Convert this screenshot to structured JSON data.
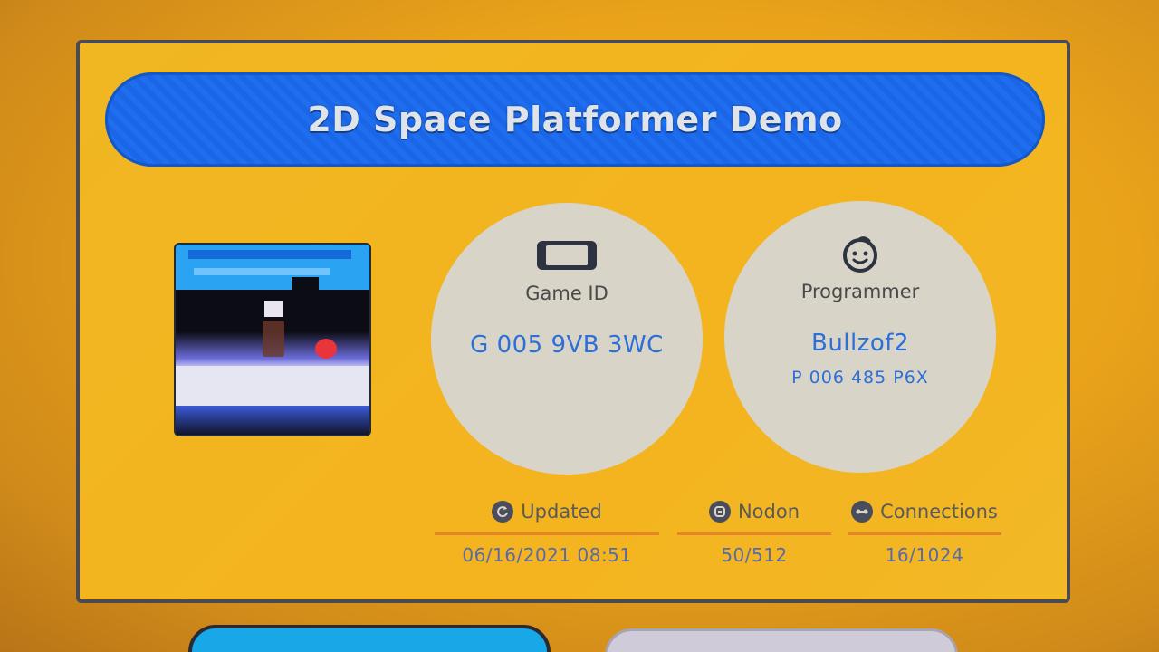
{
  "title": "2D Space Platformer Demo",
  "game_id": {
    "label": "Game ID",
    "value": "G 005 9VB 3WC",
    "icon": "handheld-console-icon"
  },
  "programmer": {
    "label": "Programmer",
    "name": "Bullzof2",
    "id": "P 006 485 P6X",
    "icon": "smiley-face-icon"
  },
  "stats": [
    {
      "label": "Updated",
      "value": "06/16/2021 08:51",
      "icon": "refresh-icon"
    },
    {
      "label": "Nodon",
      "value": "50/512",
      "icon": "nodon-icon"
    },
    {
      "label": "Connections",
      "value": "16/1024",
      "icon": "connection-icon"
    }
  ],
  "colors": {
    "accent": "#1f6ef0",
    "background": "#f0b722",
    "value_text": "#2b6fd9",
    "rule": "#e27b2a"
  }
}
